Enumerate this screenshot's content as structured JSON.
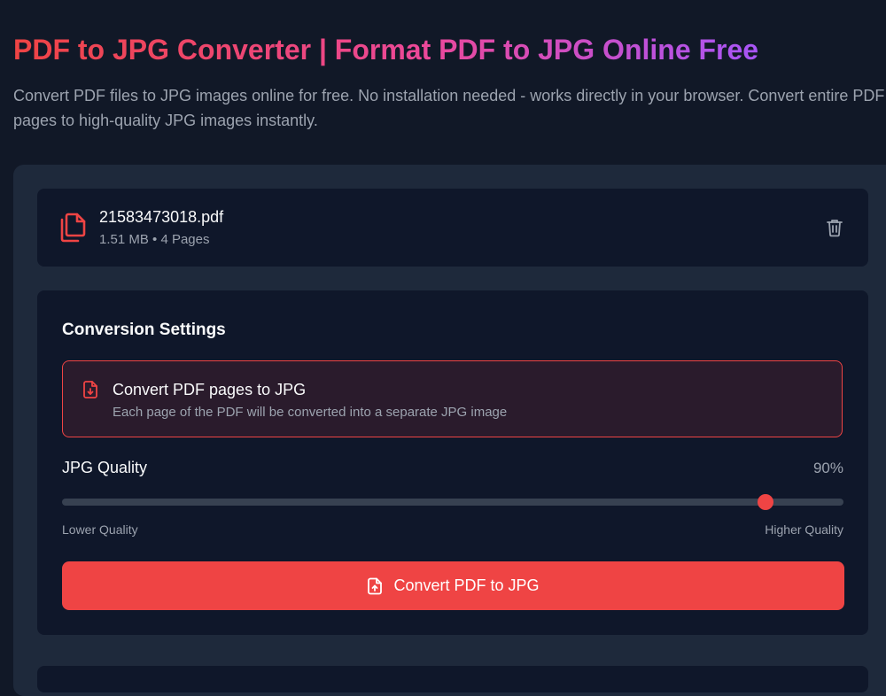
{
  "header": {
    "title": "PDF to JPG Converter | Format PDF to JPG Online Free",
    "description": "Convert PDF files to JPG images online for free. No installation needed - works directly in your browser. Convert entire PDF pages to high-quality JPG images instantly."
  },
  "file": {
    "name": "21583473018.pdf",
    "meta": "1.51 MB • 4 Pages",
    "icon": "copy-files-icon"
  },
  "settings": {
    "title": "Conversion Settings",
    "option": {
      "title": "Convert PDF pages to JPG",
      "description": "Each page of the PDF will be converted into a separate JPG image",
      "icon": "file-download-icon"
    },
    "quality": {
      "label": "JPG Quality",
      "value_text": "90%",
      "value": 0.9,
      "min_label": "Lower Quality",
      "max_label": "Higher Quality"
    },
    "convert_label": "Convert PDF to JPG"
  },
  "colors": {
    "accent": "#ef4444",
    "background": "#111827",
    "card": "#0f172a",
    "panel": "#1e293b"
  }
}
